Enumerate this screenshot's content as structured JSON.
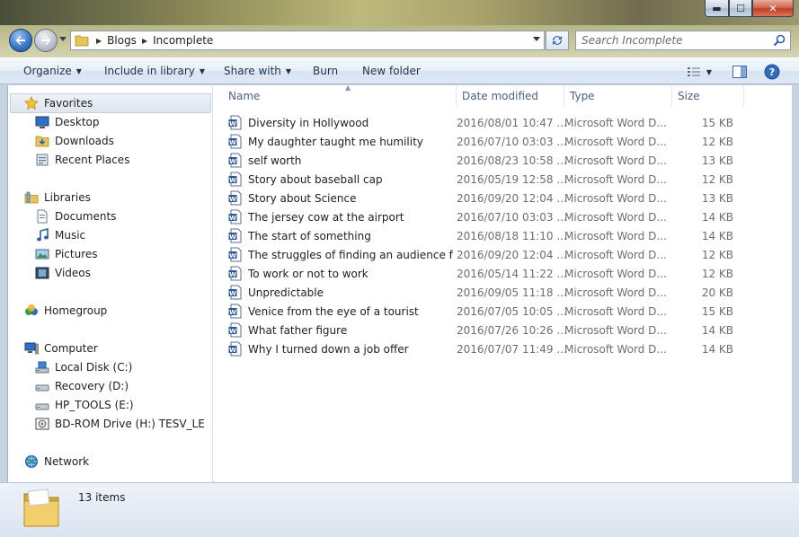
{
  "window": {
    "caption_buttons": {
      "minimize": "▬",
      "maximize": "☐",
      "close": "✕"
    }
  },
  "address": {
    "crumbs": [
      "Blogs",
      "Incomplete"
    ]
  },
  "search": {
    "placeholder": "Search Incomplete"
  },
  "toolbar": {
    "organize": "Organize",
    "include_in_library": "Include in library",
    "share_with": "Share with",
    "burn": "Burn",
    "new_folder": "New folder"
  },
  "nav": {
    "favorites": "Favorites",
    "desktop": "Desktop",
    "downloads": "Downloads",
    "recent_places": "Recent Places",
    "libraries": "Libraries",
    "documents": "Documents",
    "music": "Music",
    "pictures": "Pictures",
    "videos": "Videos",
    "homegroup": "Homegroup",
    "computer": "Computer",
    "local_disk": "Local Disk (C:)",
    "recovery": "Recovery (D:)",
    "hp_tools": "HP_TOOLS (E:)",
    "bd_rom": "BD-ROM Drive (H:) TESV_LE",
    "network": "Network"
  },
  "columns": {
    "name": "Name",
    "date": "Date modified",
    "type": "Type",
    "size": "Size"
  },
  "files": [
    {
      "name": "Diversity in Hollywood",
      "date": "2016/08/01 10:47 ...",
      "type": "Microsoft Word D...",
      "size": "15 KB"
    },
    {
      "name": "My daughter taught me humility",
      "date": "2016/07/10 03:03 ...",
      "type": "Microsoft Word D...",
      "size": "12 KB"
    },
    {
      "name": "self worth",
      "date": "2016/08/23 10:58 ...",
      "type": "Microsoft Word D...",
      "size": "13 KB"
    },
    {
      "name": "Story about baseball cap",
      "date": "2016/05/19 12:58 ...",
      "type": "Microsoft Word D...",
      "size": "12 KB"
    },
    {
      "name": "Story about Science",
      "date": "2016/09/20 12:04 ...",
      "type": "Microsoft Word D...",
      "size": "13 KB"
    },
    {
      "name": "The jersey cow at the airport",
      "date": "2016/07/10 03:03 ...",
      "type": "Microsoft Word D...",
      "size": "14 KB"
    },
    {
      "name": "The start of something",
      "date": "2016/08/18 11:10 ...",
      "type": "Microsoft Word D...",
      "size": "14 KB"
    },
    {
      "name": "The struggles of finding an audience for ...",
      "date": "2016/09/20 12:04 ...",
      "type": "Microsoft Word D...",
      "size": "12 KB"
    },
    {
      "name": "To work or not to work",
      "date": "2016/05/14 11:22 ...",
      "type": "Microsoft Word D...",
      "size": "12 KB"
    },
    {
      "name": "Unpredictable",
      "date": "2016/09/05 11:18 ...",
      "type": "Microsoft Word D...",
      "size": "20 KB"
    },
    {
      "name": "Venice from the eye of a tourist",
      "date": "2016/07/05 10:05 ...",
      "type": "Microsoft Word D...",
      "size": "15 KB"
    },
    {
      "name": "What father figure",
      "date": "2016/07/26 10:26 ...",
      "type": "Microsoft Word D...",
      "size": "14 KB"
    },
    {
      "name": "Why I turned down a job offer",
      "date": "2016/07/07 11:49 ...",
      "type": "Microsoft Word D...",
      "size": "14 KB"
    }
  ],
  "status": {
    "item_count": "13 items"
  },
  "icons": {
    "back": "back-arrow-icon",
    "forward": "forward-arrow-icon",
    "refresh": "refresh-icon",
    "search": "search-icon",
    "word": "word-document-icon",
    "folder": "folder-icon",
    "views": "views-icon",
    "preview_pane": "preview-pane-icon",
    "help": "help-icon"
  },
  "colors": {
    "accent": "#1e3250",
    "header_text": "#4d6185",
    "selection": "#dde5ef",
    "word_blue": "#2b579a"
  }
}
